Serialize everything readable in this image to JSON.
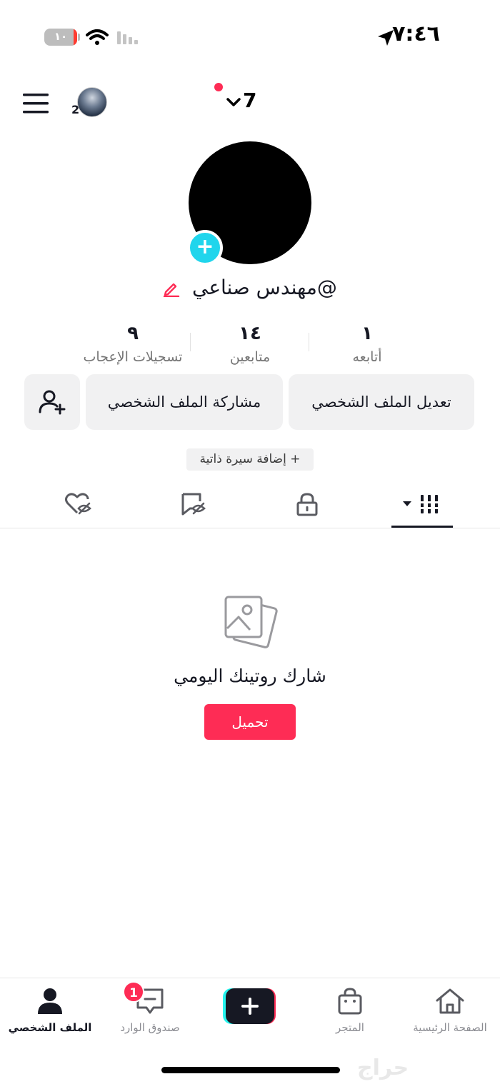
{
  "status_bar": {
    "battery_level": "١٠",
    "battery_fraction": 0.1,
    "time": "٧:٤٦"
  },
  "header": {
    "username": "7",
    "account_count": "2"
  },
  "profile": {
    "name": "@مهندس صناعي",
    "stats": {
      "following": {
        "value": "١",
        "label": "أتابعه"
      },
      "followers": {
        "value": "١٤",
        "label": "متابعين"
      },
      "likes": {
        "value": "٩",
        "label": "تسجيلات الإعجاب"
      }
    },
    "edit_label": "تعديل الملف الشخصي",
    "share_label": "مشاركة الملف الشخصي",
    "add_bio_label": "+ إضافة سيرة ذاتية"
  },
  "empty_state": {
    "title": "شارك روتينك اليومي",
    "upload_label": "تحميل"
  },
  "bottom_nav": {
    "profile": "الملف الشخصي",
    "inbox": "صندوق الوارد",
    "inbox_badge": "1",
    "shop": "المتجر",
    "home": "الصفحة الرئيسية"
  },
  "watermark": "حراج",
  "colors": {
    "accent": "#fe2c55",
    "avatar_plus": "#20d5ec",
    "button_bg": "#f1f1f2"
  }
}
